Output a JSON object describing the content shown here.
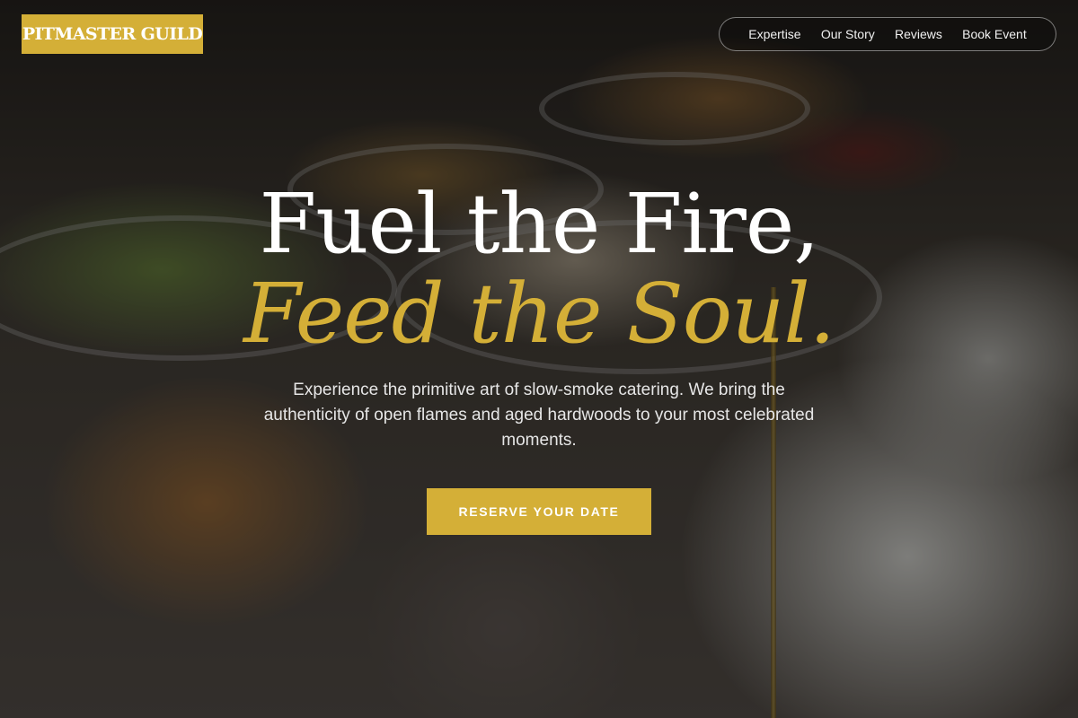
{
  "brand": {
    "logo_text": "PITMASTER GUILD",
    "accent_color": "#d4af37"
  },
  "nav": {
    "items": [
      {
        "label": "Expertise"
      },
      {
        "label": "Our Story"
      },
      {
        "label": "Reviews"
      },
      {
        "label": "Book Event"
      }
    ]
  },
  "hero": {
    "headline_line1": "Fuel the Fire,",
    "headline_line2": "Feed the Soul.",
    "subtitle": "Experience the primitive art of slow-smoke catering. We bring the authenticity of open flames and aged hardwoods to your most celebrated moments.",
    "cta_label": "RESERVE YOUR DATE",
    "background": "catering-buffet-photo"
  }
}
